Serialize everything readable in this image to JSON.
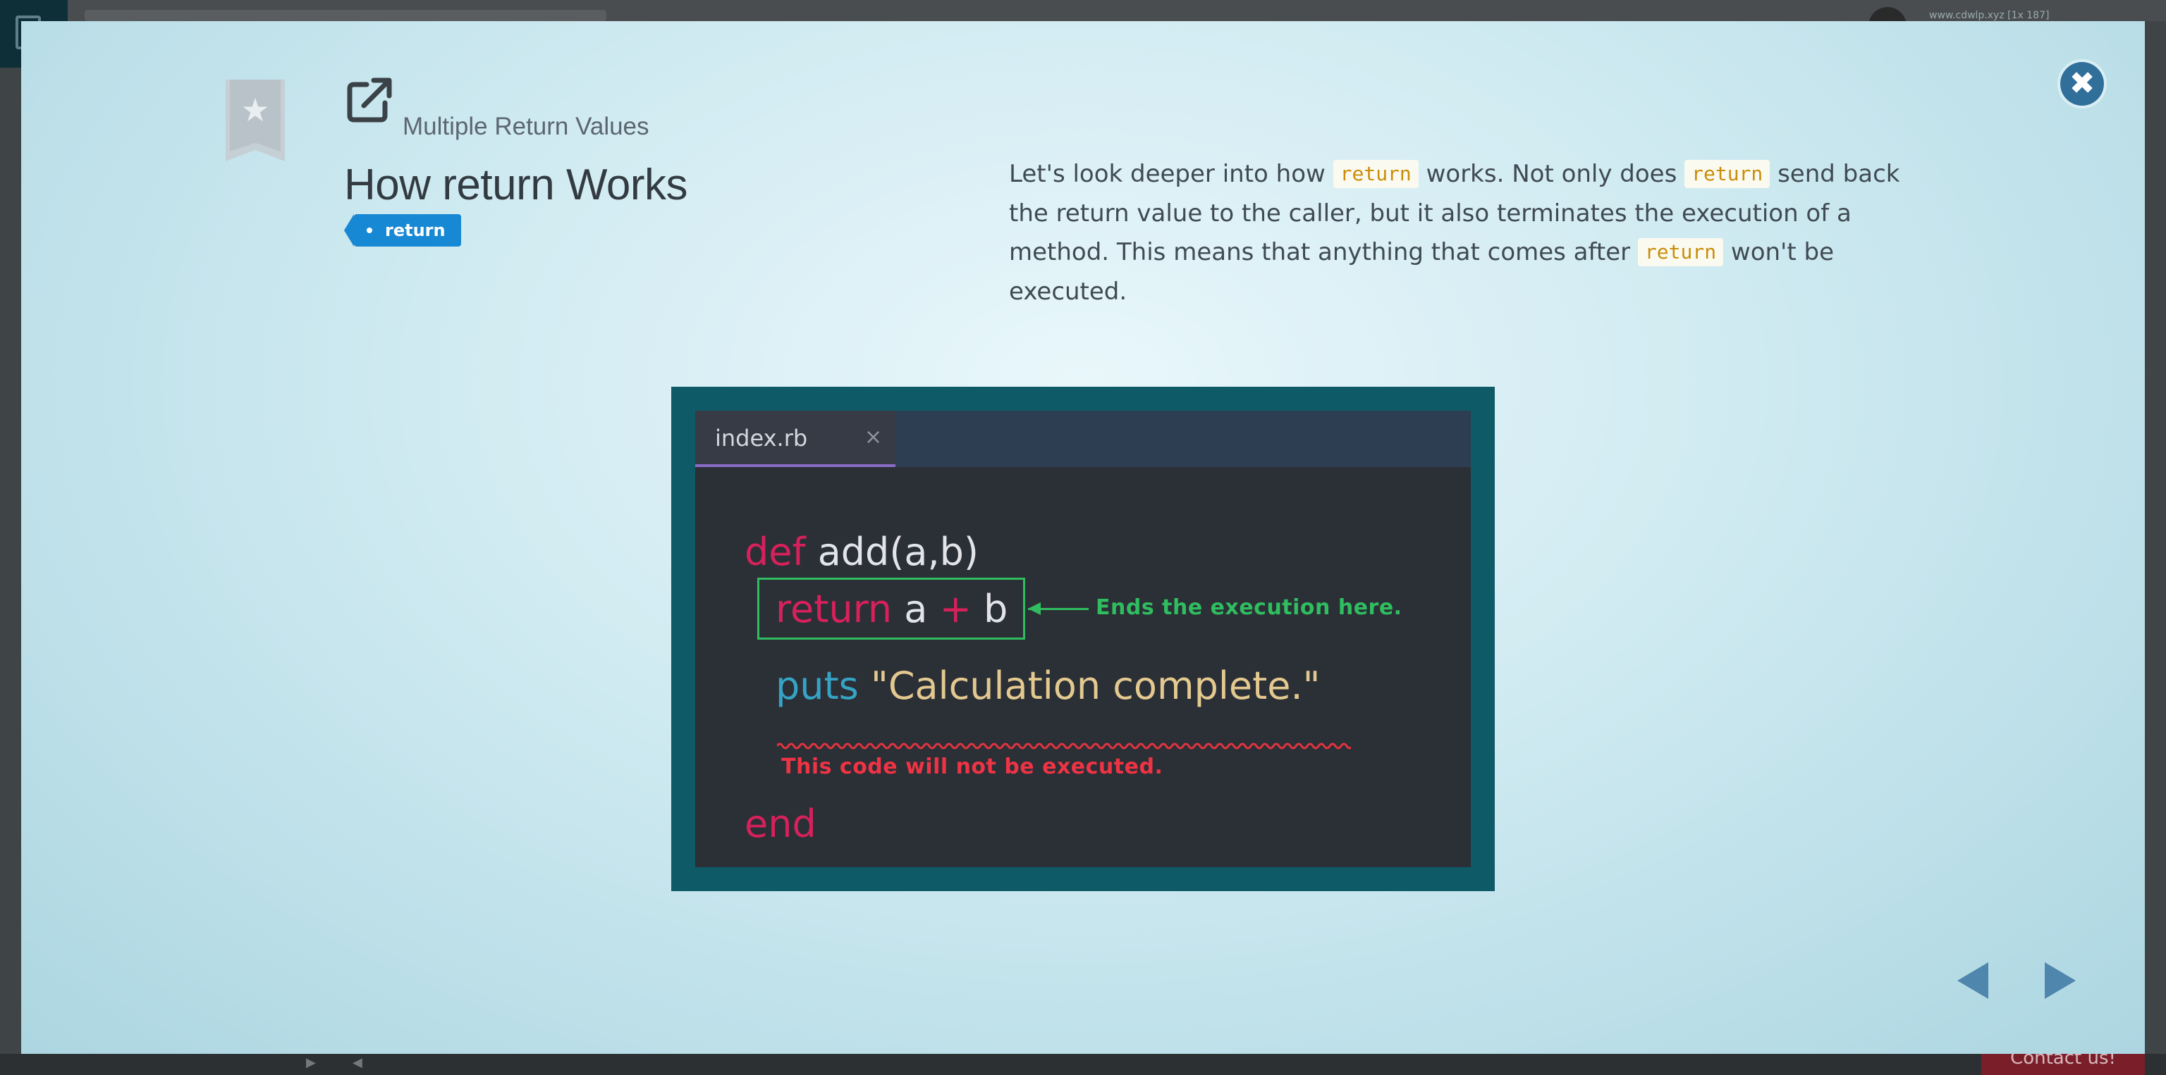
{
  "background": {
    "url_text": "www.cdwlp.xyz [1x 187]",
    "contact_label": "Contact us!"
  },
  "lesson": {
    "section": "Multiple Return Values",
    "title": "How return Works",
    "tag": "return",
    "description": [
      "Let's look deeper into how ",
      "return",
      " works. Not only does ",
      "return",
      " send back the return value to the caller, but it also terminates the execution of a method. This means that anything that comes after ",
      "return",
      " won't be executed."
    ]
  },
  "code_image": {
    "tab_label": "index.rb",
    "tab_close": "×",
    "line1_kw": "def",
    "line1_rest": "add(a,b)",
    "line2_kw": "return",
    "line2_a": "a",
    "line2_op": "+",
    "line2_b": "b",
    "line3_fn": "puts",
    "line3_str": "\"Calculation complete.\"",
    "line4_kw": "end",
    "note_green": "Ends the execution here.",
    "note_red": "This code will not be executed."
  },
  "icons": {
    "close": "close-icon",
    "bookmark": "star-bookmark-icon",
    "external": "external-link-icon",
    "prev": "prev-arrow-icon",
    "next": "next-arrow-icon"
  },
  "colors": {
    "tag_bg": "#1788d4",
    "code_keyword": "#d6215b",
    "annotation_green": "#2fbd5f",
    "annotation_red": "#ee3344",
    "nav_arrow": "#4f86ae"
  }
}
